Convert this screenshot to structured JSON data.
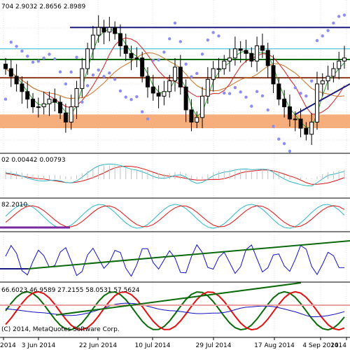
{
  "chart_data": {
    "type": "line",
    "symbol_header": "704 2.9032 2.8656 2.8989",
    "x_ticks": [
      "2014",
      "3 Jun 2014",
      "22 Jun 2014",
      "10 Jul 2014",
      "29 Jul 2014",
      "17 Aug 2014",
      "4 Sep 2014",
      "2014"
    ],
    "copyright": "(C) 2014, MetaQuotes Software Corp.",
    "panels": [
      {
        "name": "main",
        "header": "704 2.9032 2.8656 2.8989"
      },
      {
        "name": "macd",
        "header": "02 0.00442 0.00793"
      },
      {
        "name": "stochastic",
        "header": "82.2010"
      },
      {
        "name": "oscillator",
        "header": ""
      },
      {
        "name": "multi",
        "header": "66.6023 46.9589 27.2155 58.0531 57.5624"
      }
    ],
    "close": [
      2.905,
      2.9,
      2.895,
      2.89,
      2.885,
      2.88,
      2.88,
      2.882,
      2.885,
      2.883,
      2.876,
      2.87,
      2.88,
      2.892,
      2.905,
      2.918,
      2.927,
      2.932,
      2.929,
      2.932,
      2.928,
      2.92,
      2.915,
      2.912,
      2.912,
      2.9,
      2.893,
      2.889,
      2.887,
      2.89,
      2.897,
      2.906,
      2.893,
      2.878,
      2.87,
      2.873,
      2.887,
      2.898,
      2.905,
      2.905,
      2.91,
      2.912,
      2.918,
      2.917,
      2.915,
      2.91,
      2.92,
      2.917,
      2.907,
      2.895,
      2.885,
      2.88,
      2.872,
      2.872,
      2.866,
      2.862,
      2.87,
      2.895,
      2.897,
      2.9,
      2.905,
      2.91,
      2.912
    ],
    "colors": {
      "candle": "#000000",
      "orange_band": "#f6ae7c",
      "navy_line": "#1a1a80",
      "green_line": "#0a6a0a",
      "brown_line": "#8b3a1a",
      "cyan_line": "#2bb6c8",
      "sar_dots": "#8c8cf5",
      "red_line": "#e01010",
      "blue_line": "#1010c0",
      "grid": "#e0e0e0"
    }
  }
}
